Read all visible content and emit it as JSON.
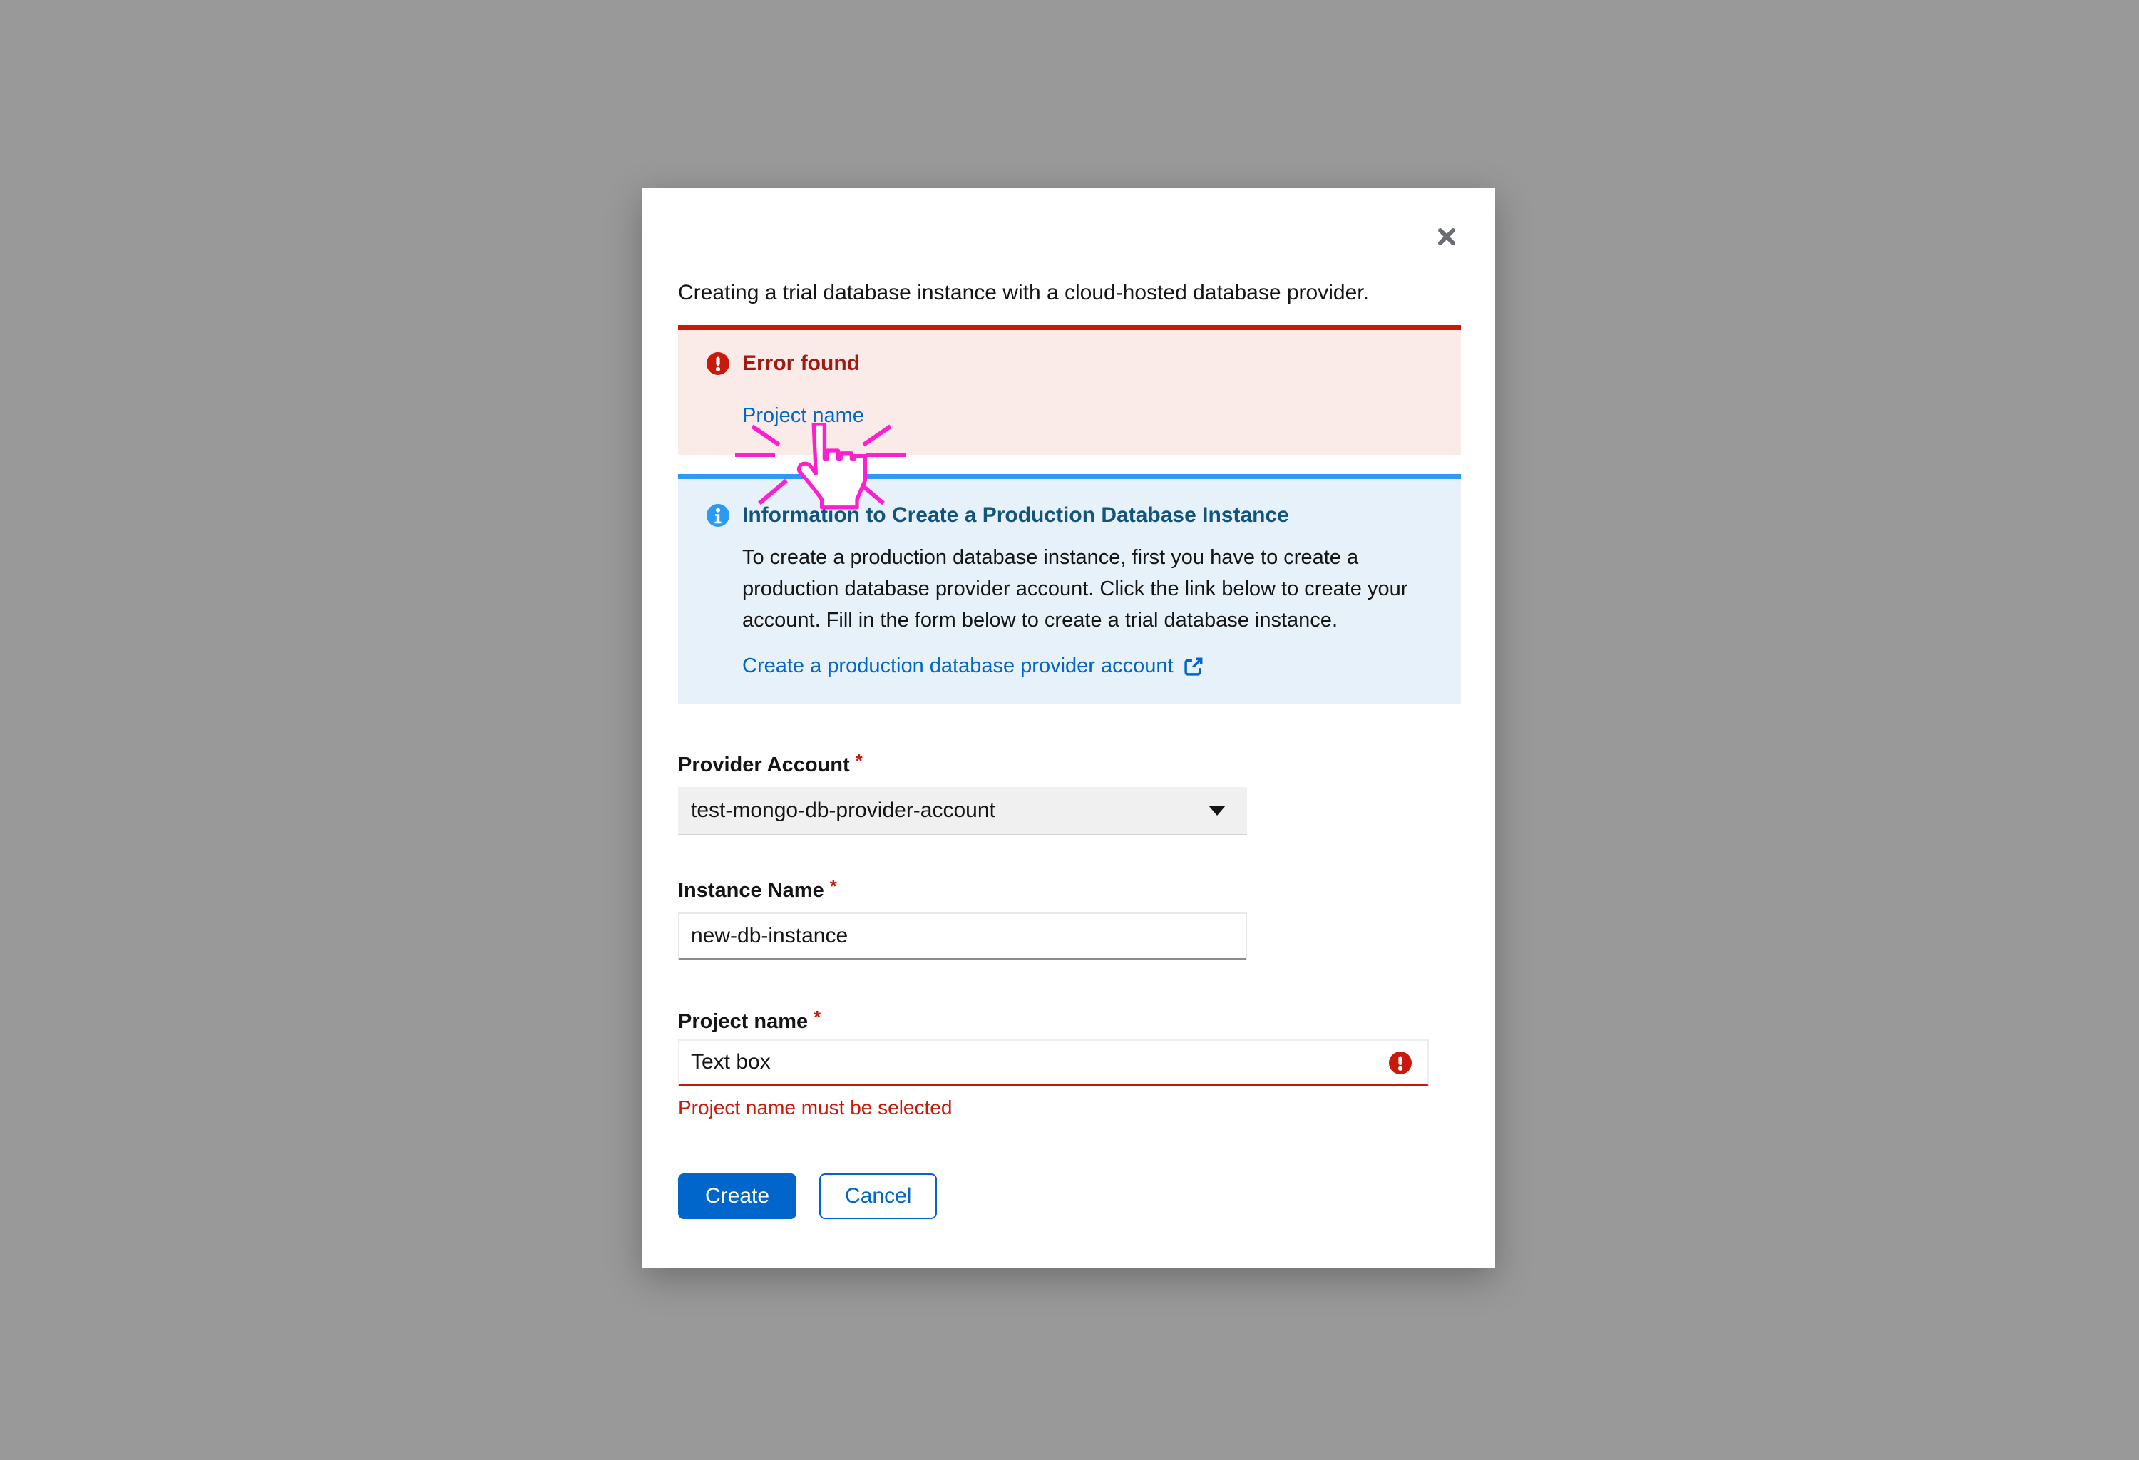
{
  "colors": {
    "backdrop": "#999999",
    "danger": "#c9190b",
    "danger_title_text": "#9e1b13",
    "danger_alert_bg": "#faeae8",
    "info": "#2b9af3",
    "info_title_text": "#14547c",
    "info_alert_bg": "#e7f1fa",
    "link_blue": "#0066cc",
    "primary_button_bg": "#0066cc",
    "text": "#151515",
    "click_cursor_magenta": "#ff1fd0",
    "close_icon_gray": "#6a6e73"
  },
  "modal": {
    "title": "Creating a trial database instance with a cloud-hosted database provider.",
    "error_alert": {
      "title": "Error found",
      "link_label": "Project name"
    },
    "info_alert": {
      "title": "Information to Create a Production Database Instance",
      "body_lines": [
        "To create a production database instance, first you have to create a",
        "production database provider account. Click the link below to create your",
        "account. Fill in the form below to create a trial database instance."
      ],
      "link_label": "Create a production database provider account"
    },
    "form": {
      "required_marker": "*",
      "provider_account": {
        "label": "Provider Account",
        "value": "test-mongo-db-provider-account"
      },
      "instance_name": {
        "label": "Instance Name",
        "value": "new-db-instance"
      },
      "project_name": {
        "label": "Project name",
        "value": "Text box",
        "error_message": "Project name must be selected"
      }
    },
    "actions": {
      "create_label": "Create",
      "cancel_label": "Cancel"
    }
  }
}
